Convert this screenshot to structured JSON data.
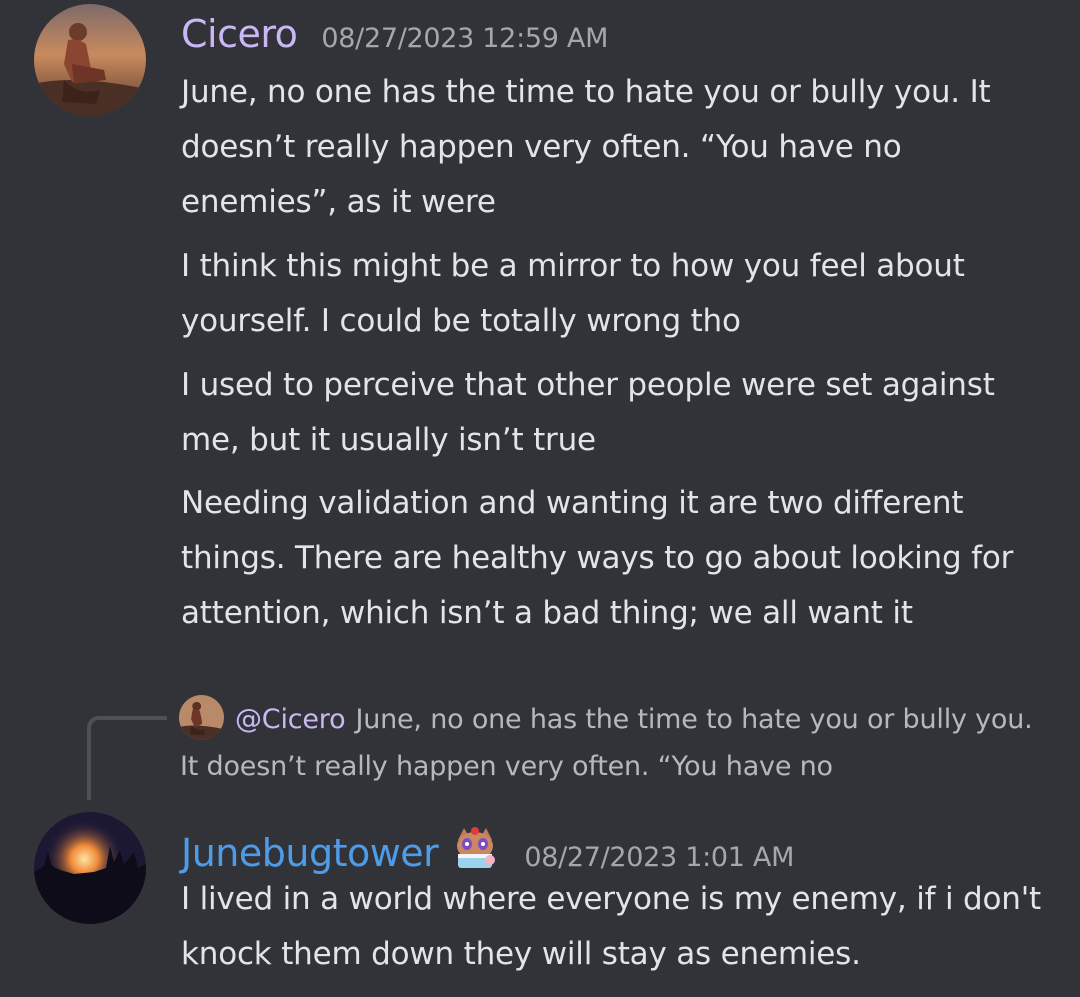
{
  "messages": [
    {
      "author": "Cicero",
      "author_color": "#c9b8f3",
      "timestamp": "08/27/2023 12:59 AM",
      "paragraphs": [
        "June, no one has the time to hate you or bully you.  It doesn’t really happen very often.  “You have no enemies”, as it were",
        "I think this might be a mirror to how you feel about yourself.  I could be totally wrong tho",
        "I used to perceive that other people were set against me, but it usually isn’t true",
        "Needing validation and wanting it are two different things.  There are healthy ways to go about looking for attention, which isn’t a bad thing; we all want it"
      ]
    },
    {
      "author": "Junebugtower",
      "author_color": "#4e9ce8",
      "timestamp": "08/27/2023 1:01 AM",
      "badge_icon": "cat-cake-emoji-icon",
      "paragraphs": [
        "I lived in a world where everyone is my enemy,  if i don't knock them down they will stay as enemies."
      ]
    }
  ],
  "reply": {
    "mention": "@Cicero",
    "preview": "June, no one has the time to hate you or bully you.  It doesn’t really happen very often.  “You have no"
  }
}
